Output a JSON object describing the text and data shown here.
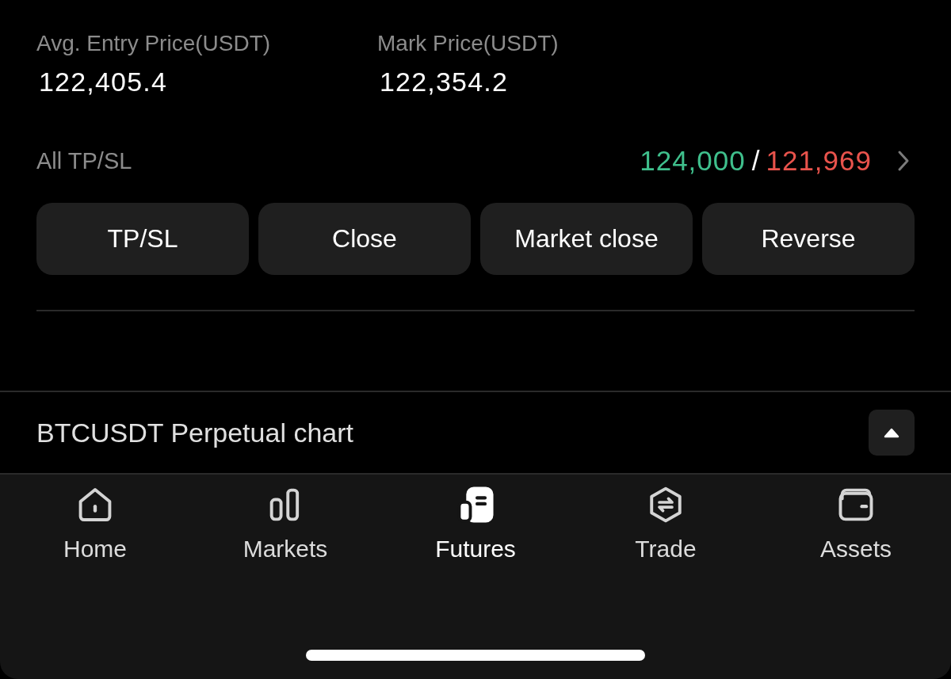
{
  "position_stats": [
    {
      "label": "Avg. Entry Price(USDT)",
      "value": "122,405.4"
    },
    {
      "label": "Mark Price(USDT)",
      "value": "122,354.2"
    }
  ],
  "tpsl": {
    "label": "All TP/SL",
    "take_profit": "124,000",
    "separator": "/",
    "stop_loss": "121,969"
  },
  "actions": [
    "TP/SL",
    "Close",
    "Market close",
    "Reverse"
  ],
  "chart_section": {
    "title": "BTCUSDT Perpetual chart",
    "expanded": false
  },
  "nav": [
    {
      "kind": "home",
      "label": "Home",
      "selected": false
    },
    {
      "kind": "markets",
      "label": "Markets",
      "selected": false
    },
    {
      "kind": "futures",
      "label": "Futures",
      "selected": true
    },
    {
      "kind": "trade",
      "label": "Trade",
      "selected": false
    },
    {
      "kind": "assets",
      "label": "Assets",
      "selected": false
    }
  ]
}
